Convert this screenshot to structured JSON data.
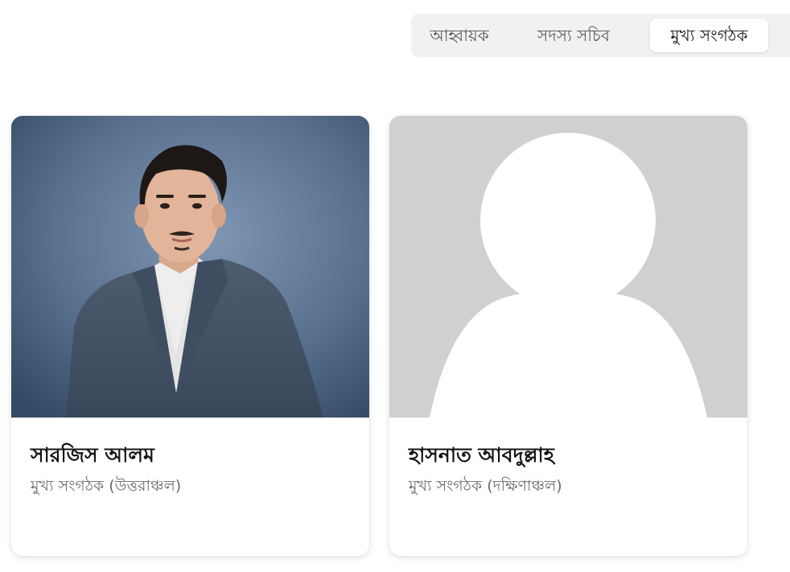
{
  "tabs": [
    {
      "label": "আহ্বায়ক",
      "active": false
    },
    {
      "label": "সদস্য সচিব",
      "active": false
    },
    {
      "label": "মুখ্য সংগঠক",
      "active": true
    }
  ],
  "members": [
    {
      "name": "সারজিস আলম",
      "role": "মুখ্য সংগঠক (উত্তরাঞ্চল)",
      "photo": "portrait-photo"
    },
    {
      "name": "হাসনাত আবদুল্লাহ",
      "role": "মুখ্য সংগঠক (দক্ষিণাঞ্চল)",
      "photo": "placeholder-avatar-icon"
    }
  ],
  "colors": {
    "tab_bar_bg": "#f1f1f4",
    "active_tab_bg": "#ffffff",
    "placeholder_bg": "#d0d0d0",
    "placeholder_fg": "#ffffff",
    "photo_bg": "#5b7391"
  }
}
